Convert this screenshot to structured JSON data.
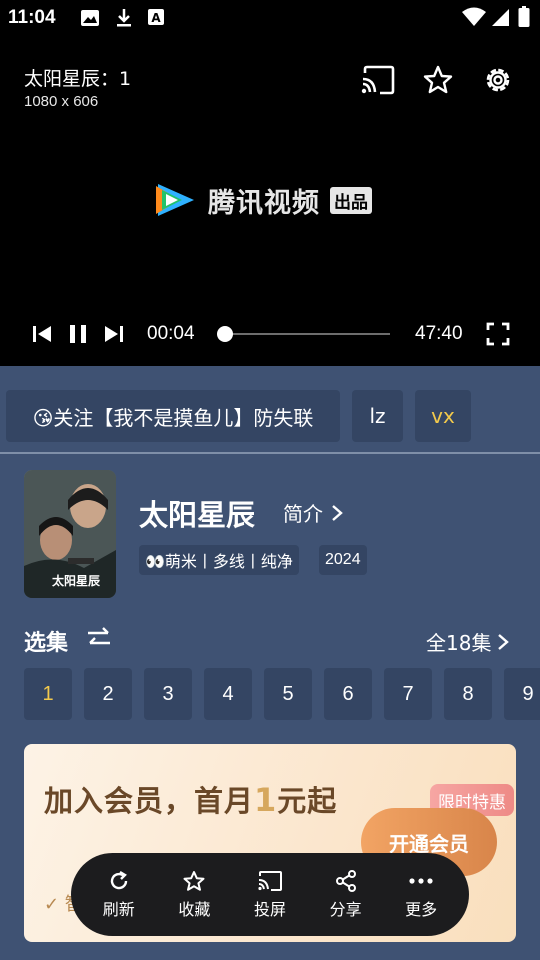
{
  "status_bar": {
    "time": "11:04"
  },
  "player": {
    "title": "太阳星辰：1",
    "resolution": "1080 x 606",
    "logo_text": "腾讯视频",
    "logo_badge": "出品",
    "current_time": "00:04",
    "duration": "47:40",
    "progress": 0.01
  },
  "chips": {
    "notice": "😘关注【我不是摸鱼儿】防失联",
    "lz": "lz",
    "vx": "vx"
  },
  "show": {
    "title": "太阳星辰",
    "intro_label": "简介",
    "source_tag": "👀萌米丨多线丨纯净",
    "year_tag": "2024"
  },
  "episodes": {
    "section_title": "选集",
    "total_label": "全18集",
    "items": [
      "1",
      "2",
      "3",
      "4",
      "5",
      "6",
      "7",
      "8",
      "9"
    ],
    "selected": "1"
  },
  "banner": {
    "title_prefix": "加入会员，首月",
    "title_num": "1",
    "title_suffix": "元起",
    "tag": "限时特惠",
    "button": "开通会员",
    "check_text": "✓ 智"
  },
  "bottom_bar": {
    "refresh": "刷新",
    "favorite": "收藏",
    "cast": "投屏",
    "share": "分享",
    "more": "更多"
  },
  "colors": {
    "page_bg": "#3f5273",
    "chip_bg": "#344563",
    "accent_yellow": "#f2c94c",
    "bottom_bar_bg": "#1c1c1e"
  }
}
